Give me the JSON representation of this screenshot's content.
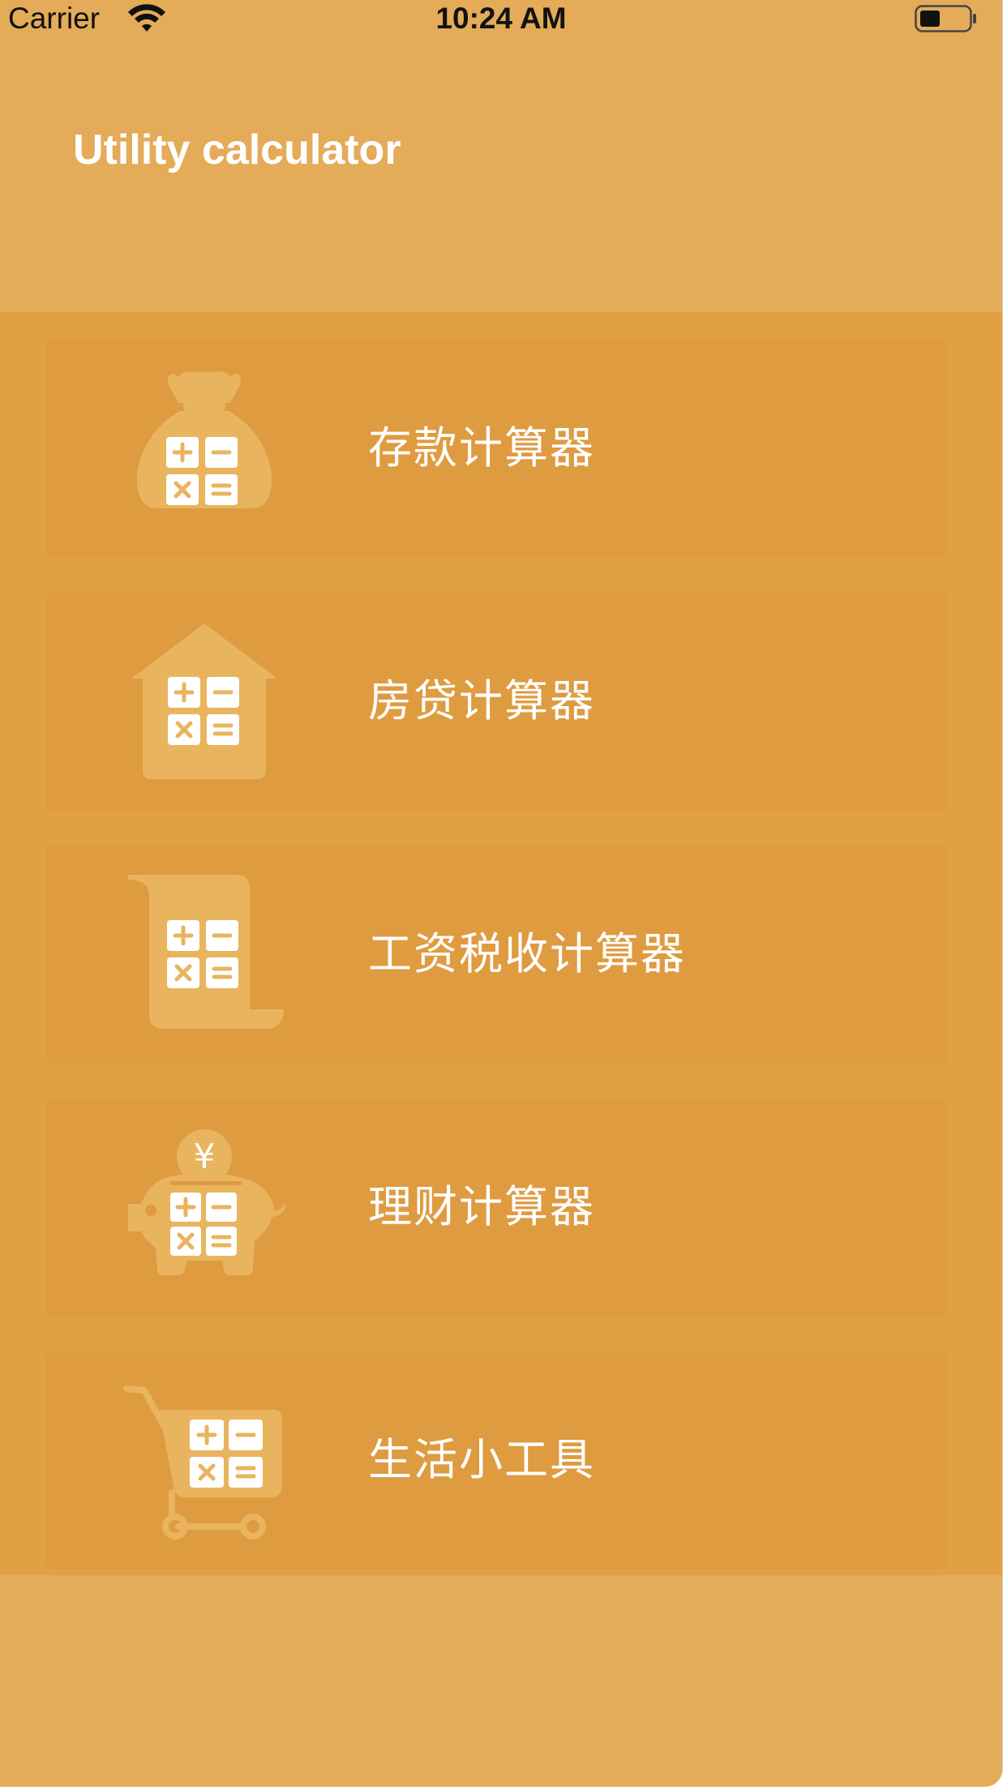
{
  "status_bar": {
    "carrier": "Carrier",
    "time": "10:24 AM",
    "wifi_icon": "wifi-icon",
    "battery_icon": "battery-icon"
  },
  "header": {
    "title": "Utility calculator"
  },
  "colors": {
    "background": "#e4ab58",
    "list_background": "#e2a045",
    "card_background": "#df9b40",
    "icon_color": "#e9b45e",
    "text": "#ffffff"
  },
  "menu": [
    {
      "label": "存款计算器",
      "icon": "money-bag-calculator-icon"
    },
    {
      "label": "房贷计算器",
      "icon": "house-calculator-icon"
    },
    {
      "label": "工资税收计算器",
      "icon": "scroll-calculator-icon"
    },
    {
      "label": "理财计算器",
      "icon": "piggy-bank-calculator-icon",
      "icon_symbol": "¥"
    },
    {
      "label": "生活小工具",
      "icon": "shopping-cart-calculator-icon"
    }
  ]
}
